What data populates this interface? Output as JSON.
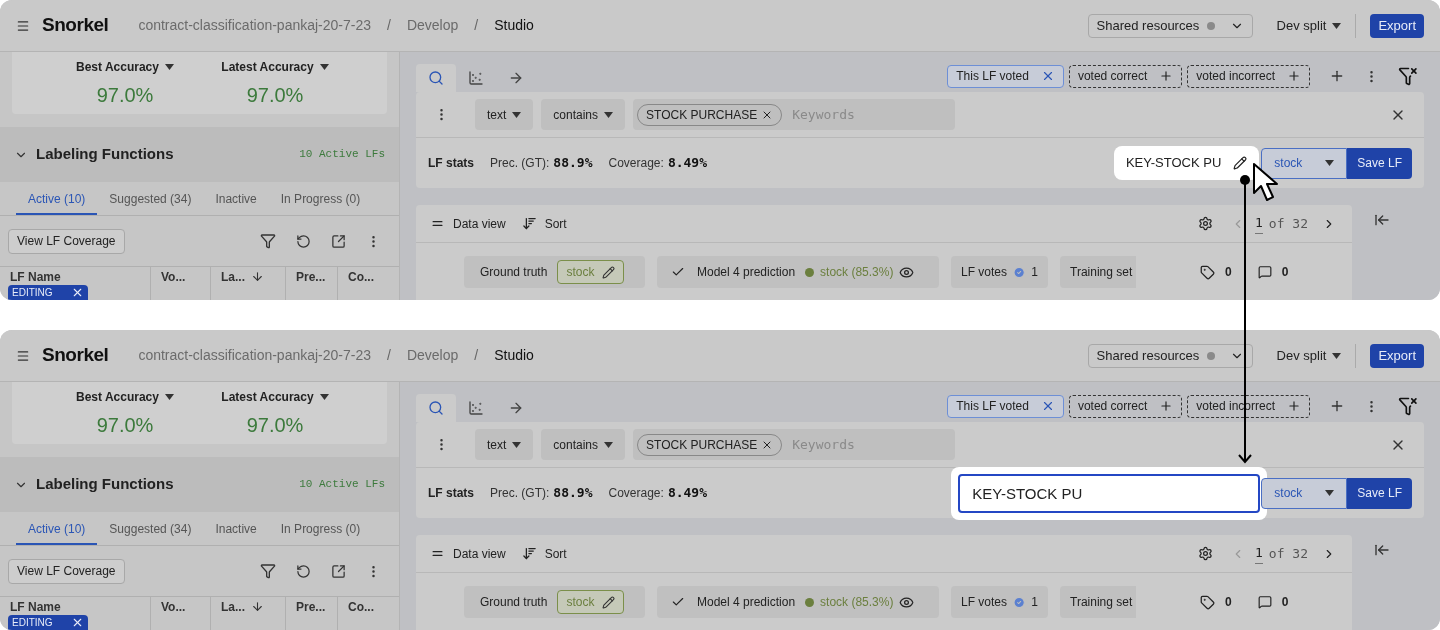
{
  "panels": [
    {
      "header": {
        "logo": "Snorkel",
        "breadcrumbs": [
          {
            "label": "contract-classification-pankaj-20-7-23",
            "current": false
          },
          {
            "separator": "/",
            "label": "Develop",
            "current": false
          },
          {
            "separator": "/",
            "label": "Studio",
            "current": true
          }
        ],
        "shared_resources": "Shared resources",
        "split": "Dev split",
        "export": "Export"
      },
      "accuracy": [
        {
          "label": "Best Accuracy",
          "value": "97.0%"
        },
        {
          "label": "Latest Accuracy",
          "value": "97.0%"
        }
      ],
      "lf_section": {
        "title": "Labeling Functions",
        "expanded": true,
        "count": "10 Active LFs"
      },
      "lf_tabs": [
        {
          "label": "Active (10)",
          "selected": true
        },
        {
          "label": "Suggested (34)",
          "selected": false
        },
        {
          "label": "Inactive",
          "selected": false
        },
        {
          "label": "In Progress (0)",
          "selected": false
        }
      ],
      "coverage_button": "View LF Coverage",
      "columns": [
        {
          "label": "LF Name",
          "sorted": false
        },
        {
          "label": "Vo...",
          "sorted": false
        },
        {
          "label": "La...",
          "sorted": true
        },
        {
          "label": "Pre...",
          "sorted": false
        },
        {
          "label": "Co...",
          "sorted": false
        }
      ],
      "editing_badge": "EDITING",
      "view_tabs": [
        {
          "kind": "search",
          "selected": true
        },
        {
          "kind": "scatter",
          "selected": false
        },
        {
          "kind": "arrow",
          "selected": false
        }
      ],
      "vote_filters": [
        {
          "label": "This LF voted",
          "active": true
        },
        {
          "label": "voted correct",
          "active": false
        },
        {
          "label": "voted incorrect",
          "active": false
        }
      ],
      "query": {
        "field": "text",
        "operator": "contains",
        "tokens": [
          "STOCK PURCHASE"
        ],
        "placeholder": "Keywords"
      },
      "lf_stats": {
        "title": "LF stats",
        "precision_label": "Prec. (GT):",
        "precision": "88.9%",
        "coverage_label": "Coverage:",
        "coverage": "8.49%"
      },
      "lf_name": {
        "kind": "label",
        "value": "KEY-STOCK PU"
      },
      "label_select": "stock",
      "save": "Save LF",
      "data_view": {
        "title": "Data view",
        "sort": "Sort",
        "page": "1",
        "page_total": "of 32"
      },
      "row": {
        "ground_truth_label": "Ground truth",
        "ground_truth": "stock",
        "prediction_label": "Model 4 prediction",
        "prediction": "stock (85.3%)",
        "lf_votes_label": "LF votes",
        "lf_votes": "1",
        "training_set": "Training set",
        "tags": "0",
        "comments": "0"
      }
    },
    {
      "header": {
        "logo": "Snorkel",
        "breadcrumbs": [
          {
            "label": "contract-classification-pankaj-20-7-23",
            "current": false
          },
          {
            "separator": "/",
            "label": "Develop",
            "current": false
          },
          {
            "separator": "/",
            "label": "Studio",
            "current": true
          }
        ],
        "shared_resources": "Shared resources",
        "split": "Dev split",
        "export": "Export"
      },
      "accuracy": [
        {
          "label": "Best Accuracy",
          "value": "97.0%"
        },
        {
          "label": "Latest Accuracy",
          "value": "97.0%"
        }
      ],
      "lf_section": {
        "title": "Labeling Functions",
        "expanded": true,
        "count": "10 Active LFs"
      },
      "lf_tabs": [
        {
          "label": "Active (10)",
          "selected": true
        },
        {
          "label": "Suggested (34)",
          "selected": false
        },
        {
          "label": "Inactive",
          "selected": false
        },
        {
          "label": "In Progress (0)",
          "selected": false
        }
      ],
      "coverage_button": "View LF Coverage",
      "columns": [
        {
          "label": "LF Name",
          "sorted": false
        },
        {
          "label": "Vo...",
          "sorted": false
        },
        {
          "label": "La...",
          "sorted": true
        },
        {
          "label": "Pre...",
          "sorted": false
        },
        {
          "label": "Co...",
          "sorted": false
        }
      ],
      "editing_badge": "EDITING",
      "view_tabs": [
        {
          "kind": "search",
          "selected": true
        },
        {
          "kind": "scatter",
          "selected": false
        },
        {
          "kind": "arrow",
          "selected": false
        }
      ],
      "vote_filters": [
        {
          "label": "This LF voted",
          "active": true
        },
        {
          "label": "voted correct",
          "active": false
        },
        {
          "label": "voted incorrect",
          "active": false
        }
      ],
      "query": {
        "field": "text",
        "operator": "contains",
        "tokens": [
          "STOCK PURCHASE"
        ],
        "placeholder": "Keywords"
      },
      "lf_stats": {
        "title": "LF stats",
        "precision_label": "Prec. (GT):",
        "precision": "88.9%",
        "coverage_label": "Coverage:",
        "coverage": "8.49%"
      },
      "lf_name": {
        "kind": "input",
        "value": "KEY-STOCK PU"
      },
      "label_select": "stock",
      "save": "Save LF",
      "data_view": {
        "title": "Data view",
        "sort": "Sort",
        "page": "1",
        "page_total": "of 32"
      },
      "row": {
        "ground_truth_label": "Ground truth",
        "ground_truth": "stock",
        "prediction_label": "Model 4 prediction",
        "prediction": "stock (85.3%)",
        "lf_votes_label": "LF votes",
        "lf_votes": "1",
        "training_set": "Training set",
        "tags": "0",
        "comments": "0"
      }
    }
  ]
}
